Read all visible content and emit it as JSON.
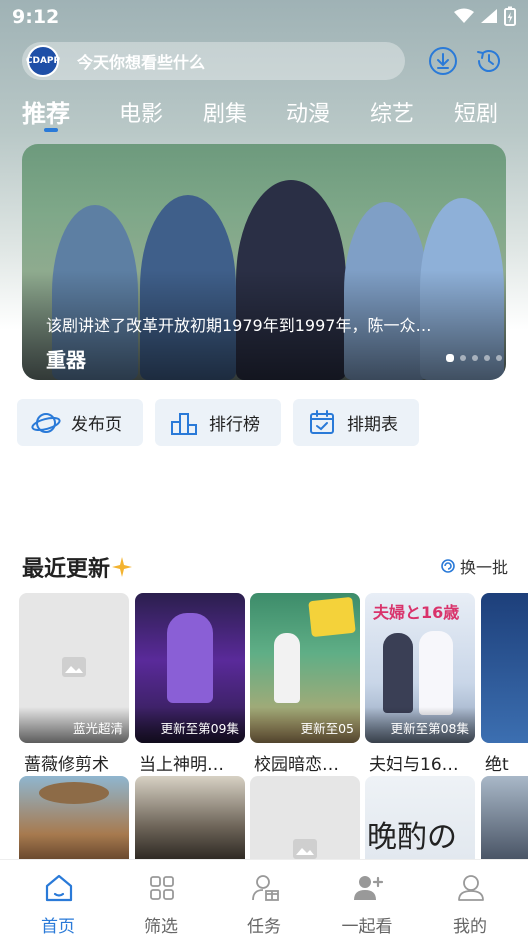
{
  "status_bar": {
    "time": "9:12"
  },
  "search": {
    "logo_text": "CDAPP",
    "placeholder": "今天你想看些什么"
  },
  "tabs": [
    {
      "label": "推荐",
      "active": true
    },
    {
      "label": "电影"
    },
    {
      "label": "剧集"
    },
    {
      "label": "动漫"
    },
    {
      "label": "综艺"
    },
    {
      "label": "短剧"
    }
  ],
  "banner": {
    "description": "该剧讲述了改革开放初期1979年到1997年，陈一众…",
    "title": "重器",
    "slide_count": 5,
    "current_slide": 1
  },
  "quick_links": [
    {
      "label": "发布页",
      "icon": "planet-icon"
    },
    {
      "label": "排行榜",
      "icon": "podium-icon"
    },
    {
      "label": "排期表",
      "icon": "calendar-icon"
    }
  ],
  "recent": {
    "title": "最近更新",
    "refresh_label": "换一批",
    "row1": [
      {
        "title": "蔷薇修剪术",
        "badge": "蓝光超清",
        "poster": "placeholder"
      },
      {
        "title": "当上神明…",
        "badge": "更新至第09集",
        "poster": "purple"
      },
      {
        "title": "校园暗恋…",
        "badge": "更新至05",
        "poster": "classroom"
      },
      {
        "title": "夫妇与16…",
        "badge": "更新至第08集",
        "poster": "wedding",
        "poster_text": "夫婦と16歳"
      },
      {
        "title": "绝t",
        "badge": "",
        "poster": "blue"
      }
    ],
    "row2": [
      {
        "poster": "western"
      },
      {
        "poster": "dark"
      },
      {
        "poster": "placeholder"
      },
      {
        "poster": "anime",
        "poster_text": "晚酌の"
      },
      {
        "poster": "partial"
      }
    ]
  },
  "bottom_nav": [
    {
      "label": "首页",
      "icon": "home-icon",
      "active": true
    },
    {
      "label": "筛选",
      "icon": "grid-icon"
    },
    {
      "label": "任务",
      "icon": "task-gift-icon"
    },
    {
      "label": "一起看",
      "icon": "add-friend-icon"
    },
    {
      "label": "我的",
      "icon": "profile-icon"
    }
  ],
  "colors": {
    "accent": "#2a7ad8",
    "quick_bg": "#ecf2f8"
  }
}
